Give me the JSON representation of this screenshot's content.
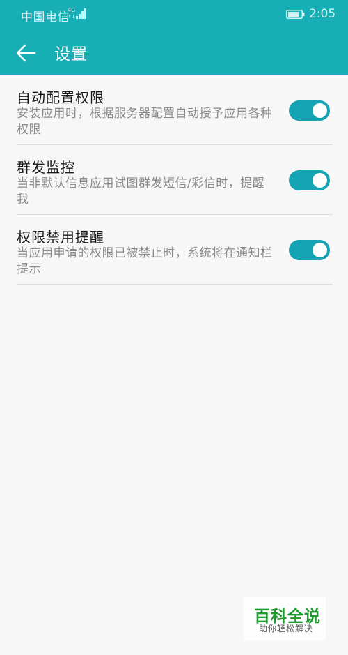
{
  "status_bar": {
    "carrier": "中国电信",
    "network": "4G",
    "time": "2:05",
    "icons": [
      "signal-icon",
      "battery-icon"
    ]
  },
  "toolbar": {
    "back_icon": "back-arrow-icon",
    "title": "设置"
  },
  "settings": [
    {
      "title": "自动配置权限",
      "description": "安装应用时，根据服务器配置自动授予应用各种权限",
      "enabled": true
    },
    {
      "title": "群发监控",
      "description": "当非默认信息应用试图群发短信/彩信时，提醒我",
      "enabled": true
    },
    {
      "title": "权限禁用提醒",
      "description": "当应用申请的权限已被禁止时，系统将在通知栏提示",
      "enabled": true
    }
  ],
  "watermark": {
    "title": "百科全说",
    "subtitle": "助你轻松解决"
  },
  "colors": {
    "app_bar": "#18aeb6",
    "toggle_on": "#14a3b3",
    "background": "#f7f7f7",
    "watermark_green": "#1d9b2c"
  }
}
